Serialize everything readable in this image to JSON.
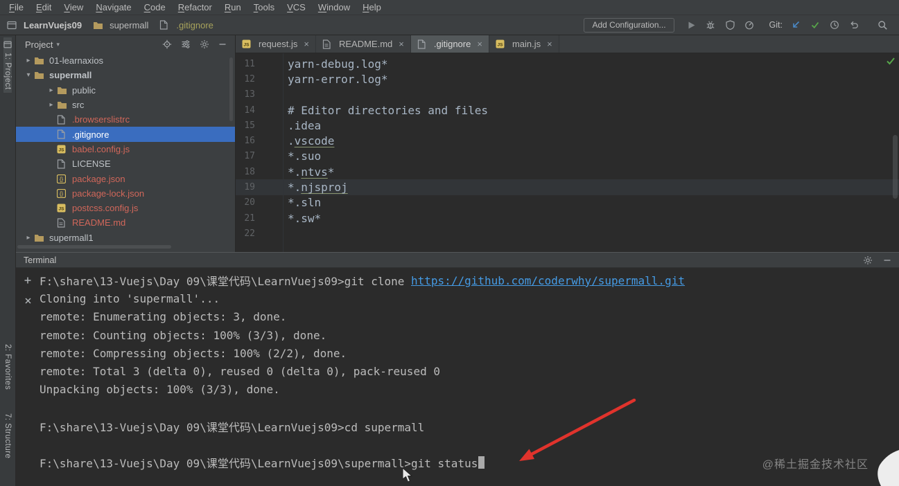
{
  "colors": {
    "selection": "#3a6dbf",
    "unversioned": "#d1675a",
    "link": "#459be5",
    "editor_text": "#a9b7c6",
    "terminal_text": "#bcbcbc",
    "green": "#57a64a",
    "arrow": "#e0332c"
  },
  "menu": {
    "items": [
      "File",
      "Edit",
      "View",
      "Navigate",
      "Code",
      "Refactor",
      "Run",
      "Tools",
      "VCS",
      "Window",
      "Help"
    ]
  },
  "toolbar": {
    "breadcrumb": [
      {
        "label": "LearnVuejs09",
        "icon": "project-icon"
      },
      {
        "label": "supermall",
        "icon": "folder-icon"
      },
      {
        "label": ".gitignore",
        "icon": "file-icon",
        "ignored": true
      }
    ],
    "add_configuration": "Add Configuration...",
    "git_label": "Git:"
  },
  "stripe": {
    "top": [
      {
        "label": "1: Project",
        "icon": "project-tool-icon",
        "active": true
      }
    ],
    "bottom": [
      {
        "label": "2: Favorites"
      },
      {
        "label": "7: Structure"
      }
    ]
  },
  "project_panel": {
    "title": "Project",
    "tree": [
      {
        "label": "01-learnaxios",
        "depth": 1,
        "chevron": "collapsed",
        "icon": "folder-icon"
      },
      {
        "label": "supermall",
        "depth": 1,
        "chevron": "expanded",
        "icon": "folder-icon",
        "bold": true
      },
      {
        "label": "public",
        "depth": 2,
        "chevron": "collapsed",
        "icon": "folder-icon"
      },
      {
        "label": "src",
        "depth": 2,
        "chevron": "collapsed",
        "icon": "folder-icon"
      },
      {
        "label": ".browserslistrc",
        "depth": 2,
        "chevron": "none",
        "icon": "file-icon",
        "status": "red"
      },
      {
        "label": ".gitignore",
        "depth": 2,
        "chevron": "none",
        "icon": "file-icon",
        "selected": true
      },
      {
        "label": "babel.config.js",
        "depth": 2,
        "chevron": "none",
        "icon": "js-icon",
        "status": "red"
      },
      {
        "label": "LICENSE",
        "depth": 2,
        "chevron": "none",
        "icon": "file-icon"
      },
      {
        "label": "package.json",
        "depth": 2,
        "chevron": "none",
        "icon": "json-icon",
        "status": "red"
      },
      {
        "label": "package-lock.json",
        "depth": 2,
        "chevron": "none",
        "icon": "json-icon",
        "status": "red"
      },
      {
        "label": "postcss.config.js",
        "depth": 2,
        "chevron": "none",
        "icon": "js-icon",
        "status": "red"
      },
      {
        "label": "README.md",
        "depth": 2,
        "chevron": "none",
        "icon": "md-icon",
        "status": "red"
      },
      {
        "label": "supermall1",
        "depth": 1,
        "chevron": "collapsed",
        "icon": "folder-icon"
      }
    ]
  },
  "editor": {
    "tabs": [
      {
        "label": "request.js",
        "icon": "js-icon"
      },
      {
        "label": "README.md",
        "icon": "md-icon"
      },
      {
        "label": ".gitignore",
        "icon": "file-icon",
        "active": true
      },
      {
        "label": "main.js",
        "icon": "js-icon"
      }
    ],
    "lines": [
      {
        "num": 11,
        "text": "yarn-debug.log*"
      },
      {
        "num": 12,
        "text": "yarn-error.log*"
      },
      {
        "num": 13,
        "text": ""
      },
      {
        "num": 14,
        "text": "# Editor directories and files"
      },
      {
        "num": 15,
        "text": ".idea"
      },
      {
        "num": 16,
        "text": ".vscode",
        "underline": "vscode"
      },
      {
        "num": 17,
        "text": "*.suo"
      },
      {
        "num": 18,
        "text": "*.ntvs*",
        "underline": "ntvs"
      },
      {
        "num": 19,
        "text": "*.njsproj",
        "underline": "njsproj",
        "caret": true
      },
      {
        "num": 20,
        "text": "*.sln"
      },
      {
        "num": 21,
        "text": "*.sw*"
      },
      {
        "num": 22,
        "text": ""
      }
    ]
  },
  "terminal": {
    "title": "Terminal",
    "toolbar": [
      {
        "name": "new-session-icon",
        "icon": "plus-icon"
      },
      {
        "name": "close-session-icon",
        "icon": "close-icon"
      }
    ],
    "lines": [
      {
        "prompt": "F:\\share\\13-Vuejs\\Day 09\\课堂代码\\LearnVuejs09>git clone ",
        "link": "https://github.com/coderwhy/supermall.git"
      },
      {
        "text": "Cloning into 'supermall'..."
      },
      {
        "text": "remote: Enumerating objects: 3, done."
      },
      {
        "text": "remote: Counting objects: 100% (3/3), done."
      },
      {
        "text": "remote: Compressing objects: 100% (2/2), done."
      },
      {
        "text": "remote: Total 3 (delta 0), reused 0 (delta 0), pack-reused 0"
      },
      {
        "text": "Unpacking objects: 100% (3/3), done."
      },
      {
        "text": ""
      },
      {
        "text": "F:\\share\\13-Vuejs\\Day 09\\课堂代码\\LearnVuejs09>cd supermall"
      },
      {
        "text": ""
      },
      {
        "text": "F:\\share\\13-Vuejs\\Day 09\\课堂代码\\LearnVuejs09\\supermall>git status",
        "cursor": true
      }
    ]
  },
  "watermark": "@稀土掘金技术社区"
}
